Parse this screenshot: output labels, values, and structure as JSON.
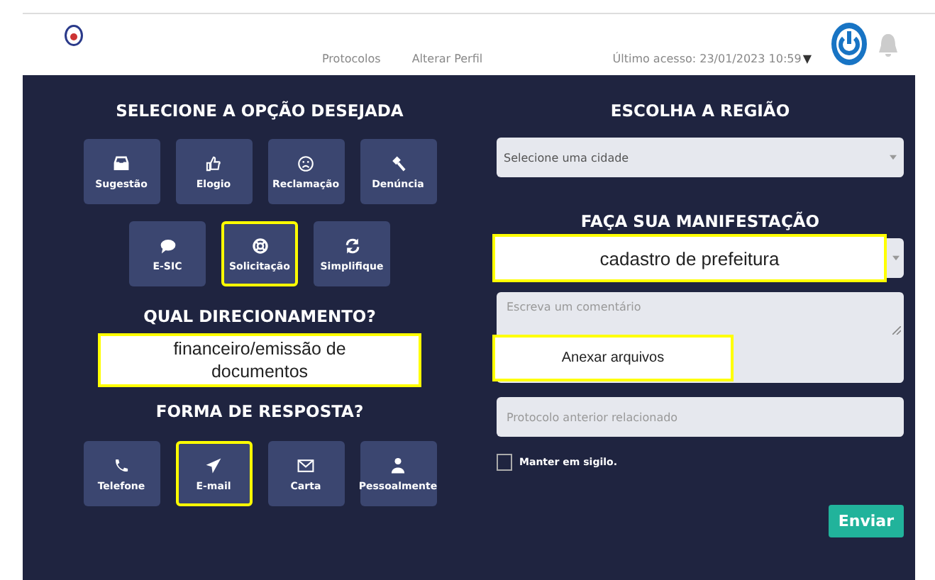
{
  "header": {
    "nav": [
      "Protocolos",
      "Alterar Perfil"
    ],
    "last_access": "Último acesso: 23/01/2023 10:59",
    "caret": "▼"
  },
  "options": {
    "title": "SELECIONE A OPÇÃO DESEJADA",
    "rows": [
      [
        {
          "label": "Sugestão",
          "selected": false
        },
        {
          "label": "Elogio",
          "selected": false
        },
        {
          "label": "Reclamação",
          "selected": false
        },
        {
          "label": "Denúncia",
          "selected": false
        }
      ],
      [
        {
          "label": "E-SIC",
          "selected": false
        },
        {
          "label": "Solicitação",
          "selected": true
        },
        {
          "label": "Simplifique",
          "selected": false
        }
      ]
    ]
  },
  "direction": {
    "title": "QUAL DIRECIONAMENTO?",
    "callout": "financeiro/emissão de documentos"
  },
  "response": {
    "title": "FORMA DE RESPOSTA?",
    "options": [
      {
        "label": "Telefone",
        "selected": false
      },
      {
        "label": "E-mail",
        "selected": true
      },
      {
        "label": "Carta",
        "selected": false
      },
      {
        "label": "Pessoalmente",
        "selected": false
      }
    ]
  },
  "region": {
    "title": "ESCOLHA A REGIÃO",
    "placeholder": "Selecione uma cidade"
  },
  "manifest": {
    "title": "FAÇA SUA MANIFESTAÇÃO",
    "type_callout": "cadastro de prefeitura",
    "comment_placeholder": "Escreva um comentário",
    "attach_callout": "Anexar arquivos",
    "protocol_placeholder": "Protocolo anterior relacionado",
    "secret": {
      "label": "Manter em sigilo.",
      "checked": false
    },
    "submit": "Enviar"
  }
}
